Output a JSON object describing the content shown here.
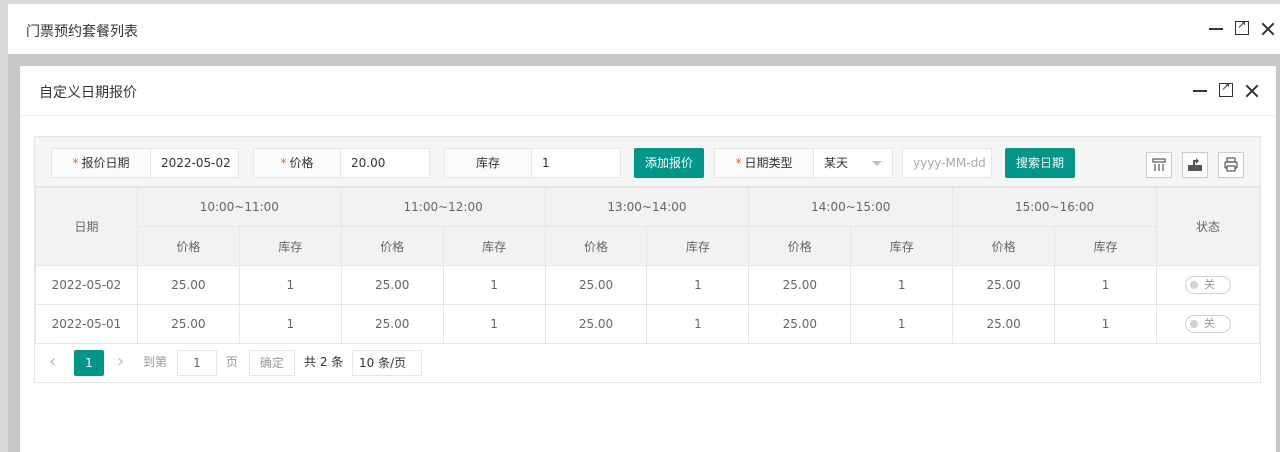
{
  "outer": {
    "title": "门票预约套餐列表"
  },
  "dialog": {
    "title": "自定义日期报价"
  },
  "toolbar": {
    "quote_date_label": "报价日期",
    "quote_date_value": "2022-05-02",
    "price_label": "价格",
    "price_value": "20.00",
    "stock_label": "库存",
    "stock_value": "1",
    "add_button": "添加报价",
    "date_type_label": "日期类型",
    "date_type_value": "某天",
    "date_placeholder": "yyyy-MM-dd",
    "search_button": "搜索日期",
    "required_mark": "*",
    "icons": [
      "columns-icon",
      "export-icon",
      "print-icon"
    ]
  },
  "table": {
    "date_header": "日期",
    "status_header": "状态",
    "slots": [
      "10:00~11:00",
      "11:00~12:00",
      "13:00~14:00",
      "14:00~15:00",
      "15:00~16:00"
    ],
    "price_header": "价格",
    "stock_header": "库存",
    "rows": [
      {
        "date": "2022-05-02",
        "cells": [
          "25.00",
          "1",
          "25.00",
          "1",
          "25.00",
          "1",
          "25.00",
          "1",
          "25.00",
          "1"
        ],
        "status": "关"
      },
      {
        "date": "2022-05-01",
        "cells": [
          "25.00",
          "1",
          "25.00",
          "1",
          "25.00",
          "1",
          "25.00",
          "1",
          "25.00",
          "1"
        ],
        "status": "关"
      }
    ]
  },
  "pager": {
    "prev": "‹",
    "current": "1",
    "next": "›",
    "goto_label": "到第",
    "goto_value": "1",
    "page_label": "页",
    "confirm": "确定",
    "total": "共 2 条",
    "per_page": "10 条/页"
  },
  "colors": {
    "accent": "#009688",
    "required": "#ff5722"
  }
}
